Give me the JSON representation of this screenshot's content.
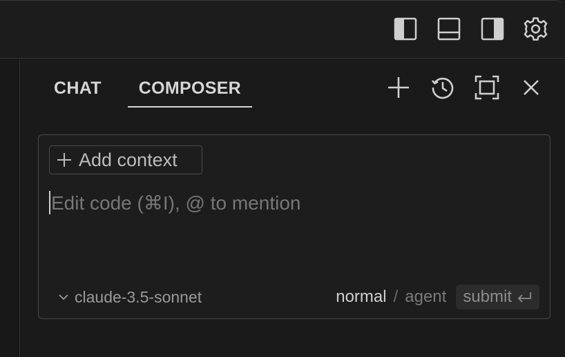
{
  "topbar": {
    "icons": [
      "toggle-primary-sidebar-icon",
      "toggle-panel-icon",
      "toggle-secondary-sidebar-icon",
      "gear-icon"
    ]
  },
  "tabs": {
    "chat_label": "CHAT",
    "composer_label": "COMPOSER",
    "active": "COMPOSER"
  },
  "panel_actions": [
    "plus-icon",
    "history-icon",
    "maximize-icon",
    "close-icon"
  ],
  "composer": {
    "add_context_label": "Add context",
    "input_placeholder": "Edit code (⌘I), @ to mention",
    "input_value": "",
    "model_label": "claude-3.5-sonnet",
    "mode_normal": "normal",
    "mode_separator": "/",
    "mode_agent": "agent",
    "active_mode": "normal",
    "submit_label": "submit"
  },
  "colors": {
    "background": "#1a1a1a",
    "panel": "#1d1d1d",
    "border": "#4a4a4a",
    "text": "#d6d6d6",
    "muted": "#7a7a7a"
  }
}
